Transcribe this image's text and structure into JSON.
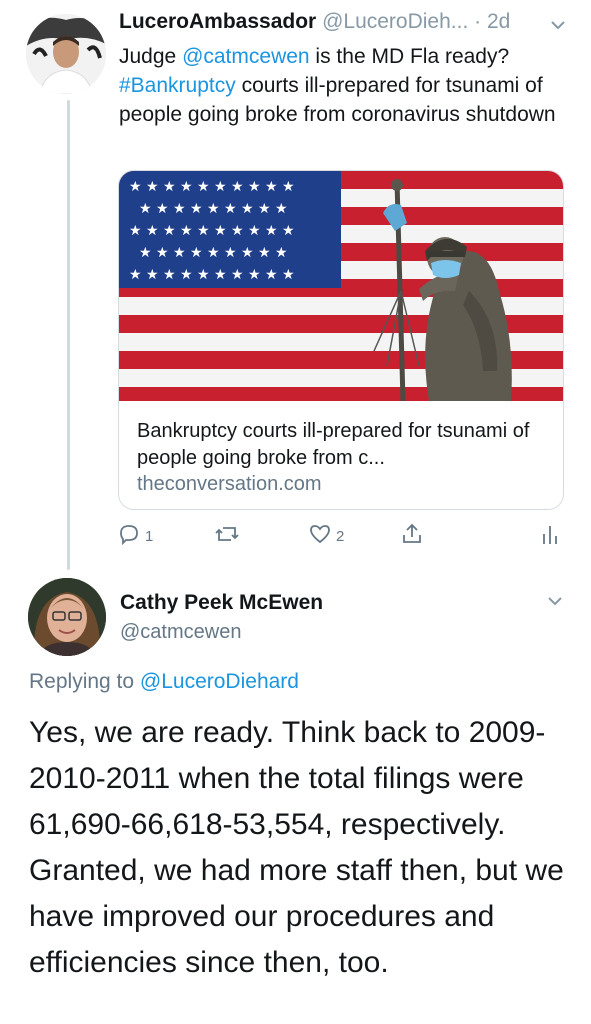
{
  "tweet1": {
    "display_name": "LuceroAmbassador",
    "handle": "@LuceroDieh...",
    "separator": "·",
    "time": "2d",
    "text_before_mention": "Judge ",
    "mention": "@catmcewen",
    "text_after_mention": " is the MD Fla ready?",
    "hashtag": "#Bankruptcy",
    "text_after_hashtag": " courts ill-prepared for tsunami of people going broke from coronavirus shutdown",
    "card": {
      "title": "Bankruptcy courts ill-prepared for tsunami of people going broke from c...",
      "domain": "theconversation.com"
    },
    "actions": {
      "reply_icon": "reply-icon",
      "reply_count": "1",
      "retweet_icon": "retweet-icon",
      "like_icon": "heart-icon",
      "like_count": "2",
      "share_icon": "share-icon",
      "analytics_icon": "analytics-icon"
    }
  },
  "tweet2": {
    "display_name": "Cathy Peek McEwen",
    "handle": "@catmcewen",
    "replying_prefix": "Replying to ",
    "replying_to": "@LuceroDiehard",
    "body": "Yes, we are ready. Think back to 2009-2010-2011 when the total filings were 61,690-66,618-53,554, respectively. Granted, we had more staff then, but we have improved our procedures and efficiencies since then, too."
  },
  "colors": {
    "link": "#1b95e0",
    "muted": "#657786",
    "flag_red": "#c8202e",
    "flag_blue": "#1f3f8a"
  }
}
